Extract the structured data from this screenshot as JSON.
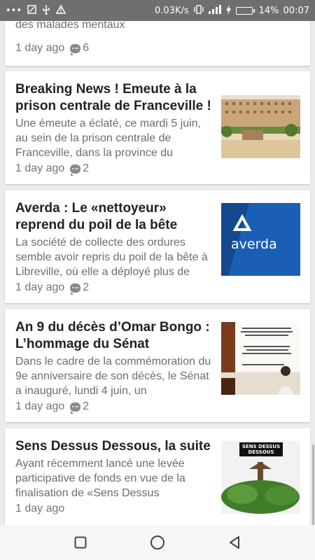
{
  "status_bar": {
    "network_speed": "0.03K/s",
    "battery_percent": "14%",
    "battery_level": 0.14,
    "time": "00:07",
    "icons": [
      "more-icon",
      "screenshot-icon",
      "usb-icon",
      "warning-icon",
      "vibrate-icon",
      "signal-icon",
      "charging-icon",
      "battery-icon"
    ]
  },
  "articles": [
    {
      "title": "",
      "excerpt": "politique visant à limiter la prolifération des malades mentaux",
      "time": "1 day ago",
      "comments": "6"
    },
    {
      "title": "Breaking News ! Emeute à la prison centrale de Franceville !",
      "excerpt": "Une émeute a éclaté, ce mardi 5 juin, au sein de la prison centrale de Franceville, dans la province du",
      "time": "1 day ago",
      "comments": "2",
      "image": "prison-building-photo"
    },
    {
      "title": "Averda : Le «nettoyeur» reprend du poil de la bête",
      "excerpt": "La société de collecte des ordures semble avoir repris du poil de la bête à Libreville, où elle a déployé plus de",
      "time": "1 day ago",
      "comments": "2",
      "image": "averda-logo-photo",
      "image_text": "averda"
    },
    {
      "title": "An 9 du décès d’Omar Bongo : L’hommage du Sénat",
      "excerpt": "Dans le cadre de la commémoration du 9e anniversaire de son décès, le Sénat a inauguré, lundi 4 juin, un",
      "time": "1 day ago",
      "comments": "2",
      "image": "senate-ceremony-photo"
    },
    {
      "title": "Sens Dessus Dessous, la suite",
      "excerpt": "Ayant récemment lancé une levée participative de fonds en vue de la finalisation de «Sens Dessus",
      "time": "1 day ago",
      "image": "upside-down-tree-poster",
      "image_text": "SENS DESSUS DESSOUS"
    }
  ],
  "nav": {
    "recent": "recent-apps-icon",
    "home": "home-icon",
    "back": "back-icon"
  },
  "colors": {
    "status_bar": "#6f6f6f",
    "battery_fill": "#2fd14a",
    "title": "#222222",
    "excerpt": "#6d6d6d",
    "averda_blue": "#1c63b7"
  }
}
